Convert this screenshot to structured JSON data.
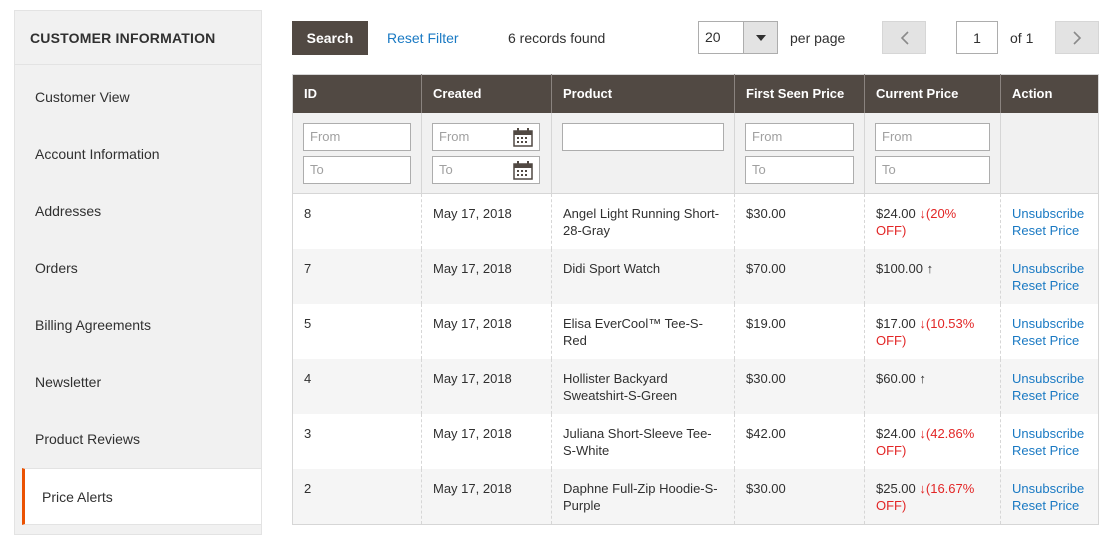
{
  "sidebar": {
    "title": "CUSTOMER INFORMATION",
    "items": [
      {
        "label": "Customer View"
      },
      {
        "label": "Account Information"
      },
      {
        "label": "Addresses"
      },
      {
        "label": "Orders"
      },
      {
        "label": "Billing Agreements"
      },
      {
        "label": "Newsletter"
      },
      {
        "label": "Product Reviews"
      },
      {
        "label": "Price Alerts"
      }
    ],
    "active_index": 7,
    "active_color": "#eb5202"
  },
  "toolbar": {
    "search_label": "Search",
    "reset_label": "Reset Filter",
    "records_found": "6 records found",
    "per_page_value": "20",
    "per_page_label": "per page",
    "page_value": "1",
    "page_of": "of 1"
  },
  "grid": {
    "columns": [
      "ID",
      "Created",
      "Product",
      "First Seen Price",
      "Current Price",
      "Action"
    ],
    "filters": {
      "from_placeholder": "From",
      "to_placeholder": "To"
    },
    "rows": [
      {
        "id": "8",
        "created": "May 17, 2018",
        "product": "Angel Light Running Short-28-Gray",
        "first_price": "$30.00",
        "current_price": "$24.00",
        "arrow": "↓",
        "change": "(20% OFF)",
        "action1": "Unsubscribe",
        "action2": "Reset Price"
      },
      {
        "id": "7",
        "created": "May 17, 2018",
        "product": "Didi Sport Watch",
        "first_price": "$70.00",
        "current_price": "$100.00",
        "arrow": "↑",
        "change": "",
        "action1": "Unsubscribe",
        "action2": "Reset Price"
      },
      {
        "id": "5",
        "created": "May 17, 2018",
        "product": "Elisa EverCool™ Tee-S-Red",
        "first_price": "$19.00",
        "current_price": "$17.00",
        "arrow": "↓",
        "change": "(10.53% OFF)",
        "action1": "Unsubscribe",
        "action2": "Reset Price"
      },
      {
        "id": "4",
        "created": "May 17, 2018",
        "product": "Hollister Backyard Sweatshirt-S-Green",
        "first_price": "$30.00",
        "current_price": "$60.00",
        "arrow": "↑",
        "change": "",
        "action1": "Unsubscribe",
        "action2": "Reset Price"
      },
      {
        "id": "3",
        "created": "May 17, 2018",
        "product": "Juliana Short-Sleeve Tee-S-White",
        "first_price": "$42.00",
        "current_price": "$24.00",
        "arrow": "↓",
        "change": "(42.86% OFF)",
        "action1": "Unsubscribe",
        "action2": "Reset Price"
      },
      {
        "id": "2",
        "created": "May 17, 2018",
        "product": "Daphne Full-Zip Hoodie-S-Purple",
        "first_price": "$30.00",
        "current_price": "$25.00",
        "arrow": "↓",
        "change": "(16.67% OFF)",
        "action1": "Unsubscribe",
        "action2": "Reset Price"
      }
    ]
  },
  "icons": {
    "calendar": "calendar-icon",
    "dropdown": "chevron-down-icon",
    "prev": "chevron-left-icon",
    "next": "chevron-right-icon"
  },
  "colors": {
    "header_bg": "#514943",
    "link": "#1979c3",
    "discount": "#e22626"
  }
}
